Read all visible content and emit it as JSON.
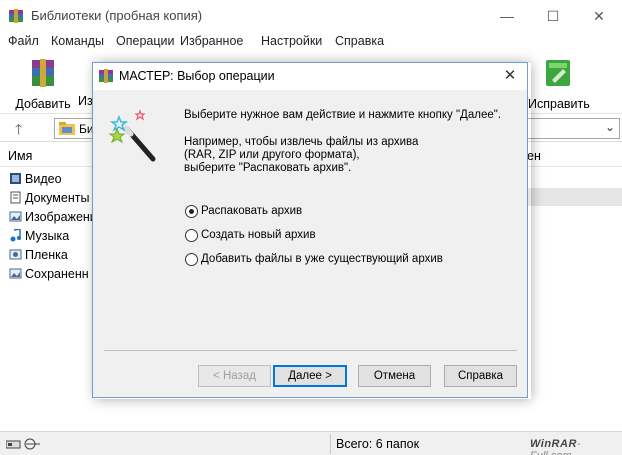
{
  "window": {
    "title": "Библиотеки (пробная копия)",
    "controls": {
      "minimize": "—",
      "maximize": "☐",
      "close": "✕"
    }
  },
  "menu": [
    "Файл",
    "Команды",
    "Операции",
    "Избранное",
    "Настройки",
    "Справка"
  ],
  "toolbar": {
    "add_label": "Добавить",
    "extract_label_partial": "Из",
    "repair_label": "Исправить"
  },
  "address": {
    "path_partial": "Би"
  },
  "list": {
    "col_name": "Имя",
    "col_tail_partial": "ен",
    "items": [
      {
        "label": "Видео",
        "icon": "video-icon"
      },
      {
        "label": "Документы",
        "icon": "documents-icon"
      },
      {
        "label": "Изображени",
        "icon": "pictures-icon"
      },
      {
        "label": "Музыка",
        "icon": "music-icon"
      },
      {
        "label": "Пленка",
        "icon": "camera-roll-icon"
      },
      {
        "label": "Сохраненн",
        "icon": "saved-pictures-icon"
      }
    ]
  },
  "status": {
    "text": "Всего: 6 папок",
    "watermark_brand": "WinRAR",
    "watermark_suffix": "-Full.com"
  },
  "dialog": {
    "title": "МАСТЕР:  Выбор операции",
    "instruction": "Выберите нужное вам действие и нажмите кнопку \"Далее\".",
    "example_lines": [
      "Например, чтобы извлечь файлы из архива",
      "(RAR, ZIP или другого формата),",
      "выберите \"Распаковать архив\"."
    ],
    "options": [
      {
        "label": "Распаковать архив",
        "checked": true
      },
      {
        "label": "Создать новый архив",
        "checked": false
      },
      {
        "label": "Добавить файлы в уже существующий архив",
        "checked": false
      }
    ],
    "buttons": {
      "back": "< Назад",
      "next": "Далее >",
      "cancel": "Отмена",
      "help": "Справка"
    }
  },
  "colors": {
    "accent": "#0078d7",
    "dialog_border": "#6e9fd4",
    "dialog_bg": "#f0f0f0"
  }
}
